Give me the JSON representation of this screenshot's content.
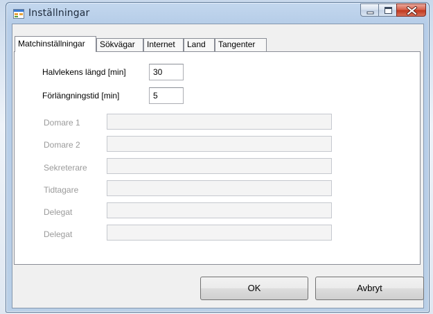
{
  "window": {
    "title": "Inställningar",
    "controls": [
      "minimize-icon",
      "maximize-icon",
      "close-icon"
    ]
  },
  "tabs": [
    {
      "label": "Matchinställningar",
      "active": true
    },
    {
      "label": "Sökvägar",
      "active": false
    },
    {
      "label": "Internet",
      "active": false
    },
    {
      "label": "Land",
      "active": false
    },
    {
      "label": "Tangenter",
      "active": false
    }
  ],
  "match_settings": {
    "half_length": {
      "label": "Halvlekens längd [min]",
      "value": "30"
    },
    "extra_time": {
      "label": "Förlängningstid [min]",
      "value": "5"
    },
    "officials": [
      {
        "label": "Domare 1",
        "value": ""
      },
      {
        "label": "Domare 2",
        "value": ""
      },
      {
        "label": "Sekreterare",
        "value": ""
      },
      {
        "label": "Tidtagare",
        "value": ""
      },
      {
        "label": "Delegat",
        "value": ""
      },
      {
        "label": "Delegat",
        "value": ""
      }
    ]
  },
  "buttons": {
    "ok": "OK",
    "cancel": "Avbryt"
  },
  "colors": {
    "titlebar": "#b9cfe7",
    "close": "#c0391f",
    "disabled_text": "#9a9a9a"
  }
}
